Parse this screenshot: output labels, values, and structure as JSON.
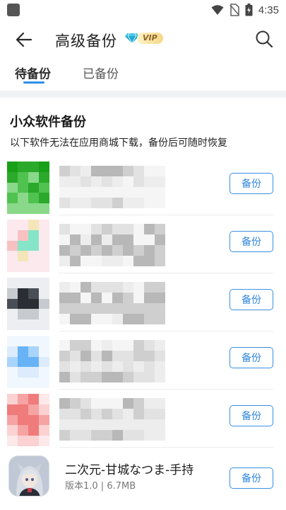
{
  "status_bar": {
    "time": "4:35"
  },
  "app_bar": {
    "title": "高级备份",
    "vip_badge": "VIP"
  },
  "tabs": [
    {
      "label": "待备份",
      "active": true
    },
    {
      "label": "已备份",
      "active": false
    }
  ],
  "section": {
    "title": "小众软件备份",
    "subtitle": "以下软件无法在应用商城下载，备份后可随时恢复"
  },
  "items": [
    {
      "name": "",
      "meta": "",
      "button": "备份",
      "icon_palette": [
        "#4fc24f",
        "#2aa92a",
        "#8ad88a",
        "#18a018"
      ]
    },
    {
      "name": "",
      "meta": "",
      "button": "备份",
      "icon_palette": [
        "#f7c1c1",
        "#86e4c8",
        "#f4e6b8",
        "#fbe9ee"
      ]
    },
    {
      "name": "",
      "meta": "",
      "button": "备份",
      "icon_palette": [
        "#2a2d33",
        "#4a4f57",
        "#c7cacf",
        "#eceef1"
      ]
    },
    {
      "name": "",
      "meta": "",
      "button": "备份",
      "icon_palette": [
        "#68b3f5",
        "#a9d4fb",
        "#dcecfc",
        "#f1f7fe"
      ]
    },
    {
      "name": "",
      "meta": "",
      "button": "备份",
      "icon_palette": [
        "#ef7b7b",
        "#f6a3a3",
        "#fbd1d1",
        "#fde9e9"
      ]
    },
    {
      "name": "二次元-甘城なつま-手持",
      "meta": "版本1.0 | 6.7MB",
      "button": "备份"
    }
  ],
  "colors": {
    "accent": "#2f8ee8",
    "vip_gold": "#f5d887"
  }
}
